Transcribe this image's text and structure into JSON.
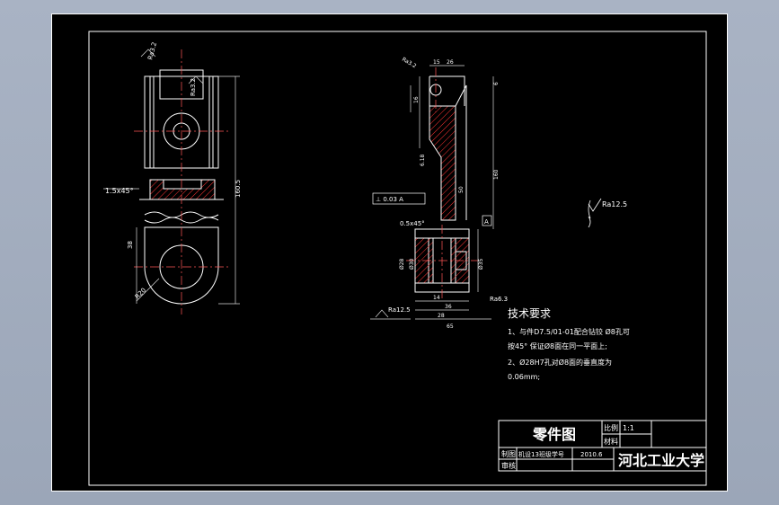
{
  "colors": {
    "background": "#9ba6b8",
    "sheet": "#000000",
    "line": "#ffffff",
    "hatch": "#ff3333",
    "dim": "#d8d8d8",
    "center": "#ff5555"
  },
  "left_view": {
    "roughness_top": "Ra3.2",
    "roughness_side": "Ra3.2",
    "chamfer": "1.5x45°",
    "dim_length": "160.5",
    "dim_width": "38",
    "dim_radius": "R20"
  },
  "right_view": {
    "roughness_top": "Ra3.2",
    "dim_top_1": "15",
    "dim_top_2": "26",
    "dim_top_3": "6",
    "dim_v1": "16",
    "dim_v2": "6.18",
    "dim_v3": "50",
    "dim_height": "160",
    "dim_chamfer": "0.5x45°",
    "tolerance_frame": "⊥ 0.03 A",
    "datum_a": "A",
    "dim_d1": "Ø28",
    "dim_d2": "Ø30",
    "dim_d3": "Ø35",
    "dim_b1": "14",
    "dim_b2": "36",
    "dim_b3": "28",
    "dim_b4": "65",
    "roughness_bottom": "Ra12.5",
    "roughness_right": "Ra6.3",
    "general_roughness": "Ra12.5"
  },
  "tech_req": {
    "title": "技术要求",
    "line1": "1、与件D7.5/01-01配合钻铰 Ø8孔可",
    "line2": "按45° 保证Ø8面在同一平面上;",
    "line3": "2、Ø28H7孔对Ø8面的垂直度为",
    "line4": "0.06mm;"
  },
  "title_block": {
    "title": "零件图",
    "scale_label": "比例",
    "scale_value": "1:1",
    "material_label": "材料",
    "drawn_label": "制图",
    "drawn_by": "机设13班级学号",
    "date": "2010.6",
    "check_label": "审核",
    "school": "河北工业大学"
  }
}
